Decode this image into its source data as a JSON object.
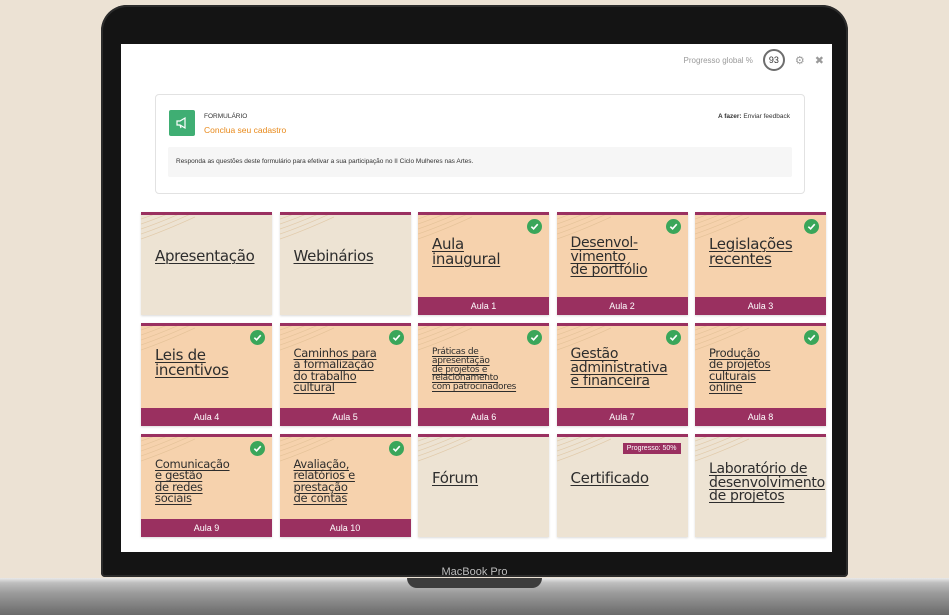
{
  "device": {
    "brand": "MacBook Pro"
  },
  "topbar": {
    "progress_label": "Progresso global %",
    "progress_value": "93"
  },
  "form": {
    "type": "FORMULÁRIO",
    "title": "Conclua seu cadastro",
    "todo_label": "A fazer:",
    "todo_value": "Enviar feedback",
    "description": "Responda as questões deste formulário para efetivar a sua participação no II Ciclo Mulheres nas Artes."
  },
  "colors": {
    "accent": "#9a3060",
    "check": "#3aa65a",
    "form_icon": "#3fae73",
    "form_title": "#e8891a"
  },
  "tiles": [
    {
      "title": "Apresentação",
      "style": "beige",
      "lesson": "",
      "done": false
    },
    {
      "title": "Webinários",
      "style": "beige",
      "lesson": "",
      "done": false
    },
    {
      "title": "Aula\ninaugural",
      "style": "peach",
      "lesson": "Aula 1",
      "done": true
    },
    {
      "title": "Desenvol-\nvimento\nde portfólio",
      "style": "peach",
      "lesson": "Aula 2",
      "done": true
    },
    {
      "title": "Legislações\nrecentes",
      "style": "peach",
      "lesson": "Aula 3",
      "done": true
    },
    {
      "title": "Leis de\nincentivos",
      "style": "peach",
      "lesson": "Aula 4",
      "done": true
    },
    {
      "title": "Caminhos para\na formalização\ndo trabalho\ncultural",
      "style": "peach",
      "lesson": "Aula 5",
      "done": true
    },
    {
      "title": "Práticas de\napresentação\nde projetos e\nrelacionamento\ncom patrocinadores",
      "style": "peach",
      "lesson": "Aula 6",
      "done": true
    },
    {
      "title": "Gestão\nadministrativa\ne financeira",
      "style": "peach",
      "lesson": "Aula 7",
      "done": true
    },
    {
      "title": "Produção\nde projetos\nculturais\nonline",
      "style": "peach",
      "lesson": "Aula 8",
      "done": true
    },
    {
      "title": "Comunicação\ne gestão\nde redes\nsociais",
      "style": "peach",
      "lesson": "Aula 9",
      "done": true
    },
    {
      "title": "Avaliação,\nrelatórios e\nprestação\nde contas",
      "style": "peach",
      "lesson": "Aula 10",
      "done": true
    },
    {
      "title": "Fórum",
      "style": "beige",
      "lesson": "",
      "done": false
    },
    {
      "title": "Certificado",
      "style": "beige",
      "lesson": "",
      "done": false,
      "badge": "Progresso: 50%"
    },
    {
      "title": "Laboratório de\ndesenvolvimento\nde projetos",
      "style": "beige",
      "lesson": "",
      "done": false
    }
  ]
}
